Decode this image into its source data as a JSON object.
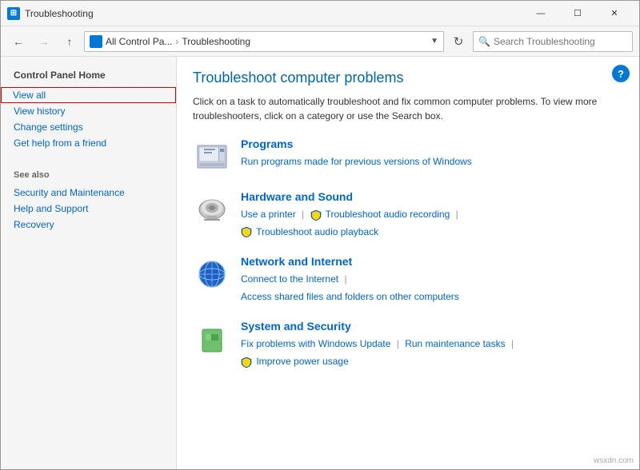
{
  "window": {
    "title": "Troubleshooting",
    "icon": "CP",
    "controls": {
      "minimize": "—",
      "maximize": "☐",
      "close": "✕"
    }
  },
  "addressbar": {
    "breadcrumb_icon": "CP",
    "breadcrumb_prefix": "All Control Pa...",
    "breadcrumb_current": "Troubleshooting",
    "search_placeholder": "Search Troubleshooting"
  },
  "sidebar": {
    "heading": "Control Panel Home",
    "links": [
      {
        "label": "View all",
        "highlighted": true
      },
      {
        "label": "View history",
        "highlighted": false
      },
      {
        "label": "Change settings",
        "highlighted": false
      },
      {
        "label": "Get help from a friend",
        "highlighted": false
      }
    ],
    "see_also_title": "See also",
    "see_also_links": [
      "Security and Maintenance",
      "Help and Support",
      "Recovery"
    ]
  },
  "content": {
    "title": "Troubleshoot computer problems",
    "description": "Click on a task to automatically troubleshoot and fix common computer problems. To view more troubleshooters, click on a category or use the Search box.",
    "categories": [
      {
        "id": "programs",
        "title": "Programs",
        "links": [
          {
            "label": "Run programs made for previous versions of Windows",
            "shield": false
          }
        ]
      },
      {
        "id": "hardware",
        "title": "Hardware and Sound",
        "links": [
          {
            "label": "Use a printer",
            "shield": false
          },
          {
            "label": "Troubleshoot audio recording",
            "shield": true
          },
          {
            "label": "Troubleshoot audio playback",
            "shield": true
          }
        ]
      },
      {
        "id": "network",
        "title": "Network and Internet",
        "links": [
          {
            "label": "Connect to the Internet",
            "shield": false
          },
          {
            "label": "Access shared files and folders on other computers",
            "shield": false
          }
        ]
      },
      {
        "id": "security",
        "title": "System and Security",
        "links": [
          {
            "label": "Fix problems with Windows Update",
            "shield": false
          },
          {
            "label": "Run maintenance tasks",
            "shield": false
          },
          {
            "label": "Improve power usage",
            "shield": true
          }
        ]
      }
    ]
  },
  "watermark": "wsxdn.com"
}
